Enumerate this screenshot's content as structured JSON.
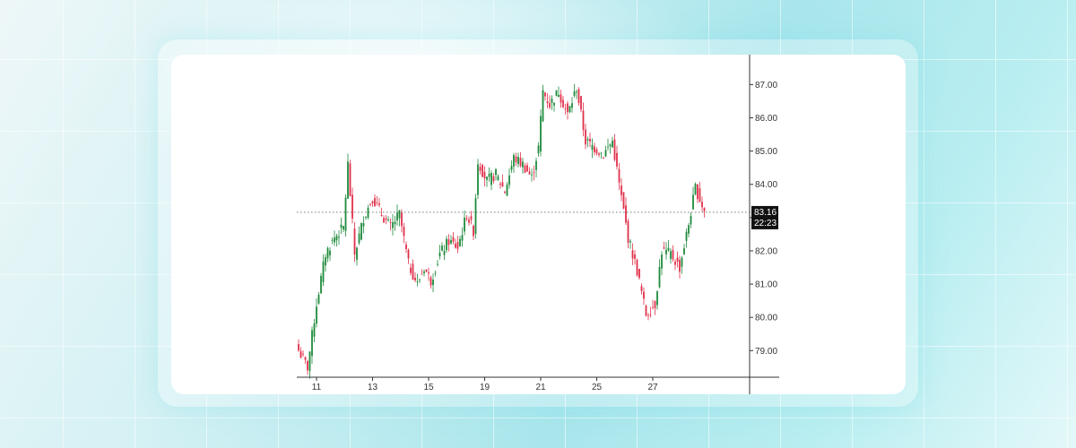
{
  "chart_data": {
    "type": "candlestick",
    "title": "",
    "xlabel": "",
    "ylabel": "",
    "ylim": [
      78.2,
      87.9
    ],
    "y_ticks": [
      79,
      80,
      81,
      82,
      83,
      84,
      85,
      86,
      87
    ],
    "y_tick_labels": [
      "79.00",
      "80.00",
      "81.00",
      "82.00",
      "83.00",
      "84.00",
      "85.00",
      "86.00",
      "87.00"
    ],
    "x_tick_labels": [
      "11",
      "13",
      "15",
      "19",
      "21",
      "25",
      "27"
    ],
    "x_tick_index": [
      8,
      33,
      58,
      83,
      108,
      133,
      158
    ],
    "grid": false,
    "last_price": "83.16",
    "countdown": "22:23",
    "colors": {
      "up": "#1e8a3c",
      "down": "#e0304a",
      "axis": "#333333",
      "price_bg": "#111111"
    },
    "close_path": [
      [
        0,
        79.0
      ],
      [
        4,
        78.5
      ],
      [
        8,
        80.4
      ],
      [
        12,
        81.9
      ],
      [
        16,
        82.4
      ],
      [
        20,
        82.7
      ],
      [
        22,
        84.6
      ],
      [
        25,
        81.9
      ],
      [
        29,
        83.0
      ],
      [
        33,
        83.6
      ],
      [
        37,
        83.1
      ],
      [
        41,
        82.7
      ],
      [
        45,
        83.1
      ],
      [
        49,
        81.6
      ],
      [
        53,
        81.0
      ],
      [
        56,
        81.5
      ],
      [
        59,
        81.1
      ],
      [
        63,
        81.9
      ],
      [
        67,
        82.3
      ],
      [
        71,
        82.1
      ],
      [
        75,
        83.1
      ],
      [
        78,
        82.6
      ],
      [
        80,
        84.7
      ],
      [
        84,
        84.1
      ],
      [
        88,
        84.3
      ],
      [
        92,
        83.8
      ],
      [
        96,
        84.8
      ],
      [
        100,
        84.6
      ],
      [
        104,
        84.2
      ],
      [
        107,
        85.1
      ],
      [
        109,
        86.8
      ],
      [
        112,
        86.4
      ],
      [
        116,
        86.8
      ],
      [
        120,
        86.1
      ],
      [
        124,
        86.9
      ],
      [
        128,
        85.3
      ],
      [
        132,
        85.1
      ],
      [
        136,
        84.9
      ],
      [
        140,
        85.3
      ],
      [
        143,
        84.0
      ],
      [
        147,
        82.4
      ],
      [
        151,
        81.4
      ],
      [
        155,
        80.1
      ],
      [
        159,
        80.4
      ],
      [
        162,
        82.0
      ],
      [
        166,
        81.9
      ],
      [
        170,
        81.5
      ],
      [
        174,
        82.8
      ],
      [
        177,
        83.9
      ],
      [
        181,
        83.2
      ]
    ]
  }
}
